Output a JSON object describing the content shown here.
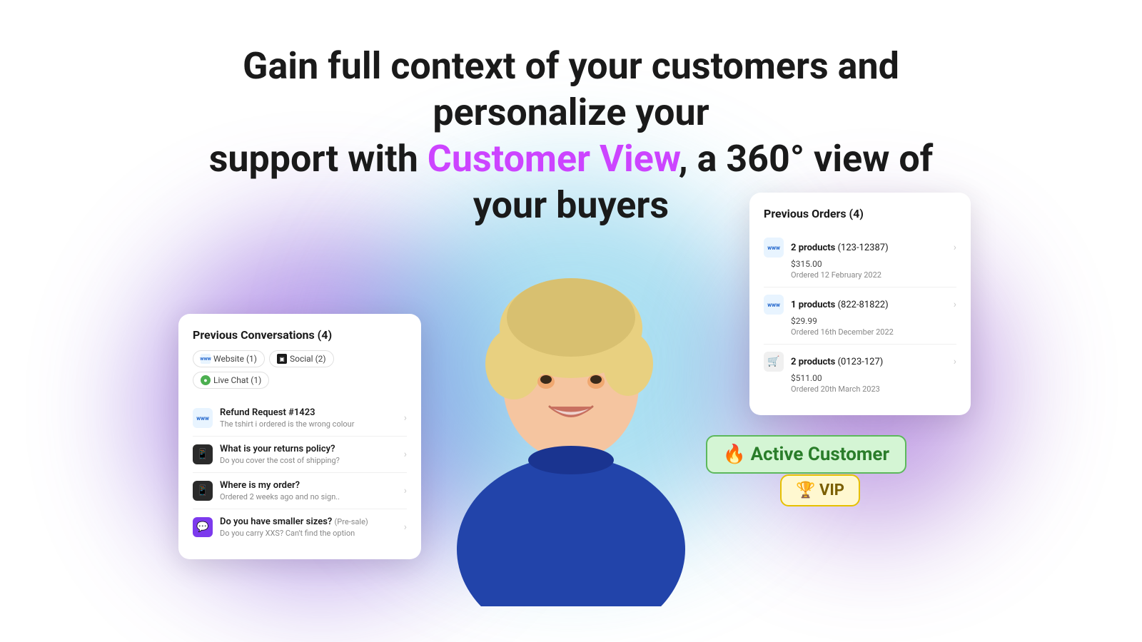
{
  "headline": {
    "line1": "Gain full context of your customers and personalize your",
    "line2_before": "support with ",
    "line2_highlight": "Customer View",
    "line2_after": ", a 360° view of your buyers"
  },
  "conversations_card": {
    "title": "Previous Conversations (4)",
    "tabs": [
      {
        "label": "Website (1)",
        "type": "www"
      },
      {
        "label": "Social (2)",
        "type": "social"
      },
      {
        "label": "Live Chat (1)",
        "type": "livechat"
      }
    ],
    "items": [
      {
        "icon_type": "www",
        "title": "Refund Request #1423",
        "subtitle": "The tshirt i ordered is the wrong colour",
        "tag": ""
      },
      {
        "icon_type": "phone",
        "title": "What is your returns policy?",
        "subtitle": "Do you cover the cost of shipping?",
        "tag": ""
      },
      {
        "icon_type": "phone",
        "title": "Where is my order?",
        "subtitle": "Ordered 2 weeks ago and no sign..",
        "tag": ""
      },
      {
        "icon_type": "purple",
        "title": "Do you have smaller sizes?",
        "tag": "(Pre-sale)",
        "subtitle": "Do you carry XXS? Can't find the option"
      }
    ]
  },
  "orders_card": {
    "title": "Previous Orders (4)",
    "items": [
      {
        "icon_type": "www",
        "products": "2 products",
        "order_id": "(123-12387)",
        "price": "$315.00",
        "date": "Ordered 12 February 2022"
      },
      {
        "icon_type": "www",
        "products": "1 products",
        "order_id": "(822-81822)",
        "price": "$29.99",
        "date": "Ordered 16th December 2022"
      },
      {
        "icon_type": "cart",
        "products": "2 products",
        "order_id": "(0123-127)",
        "price": "$511.00",
        "date": "Ordered 20th March 2023"
      }
    ]
  },
  "badges": {
    "active_customer": {
      "emoji": "🔥",
      "label": "Active Customer"
    },
    "vip": {
      "emoji": "🏆",
      "label": "VIP"
    }
  }
}
